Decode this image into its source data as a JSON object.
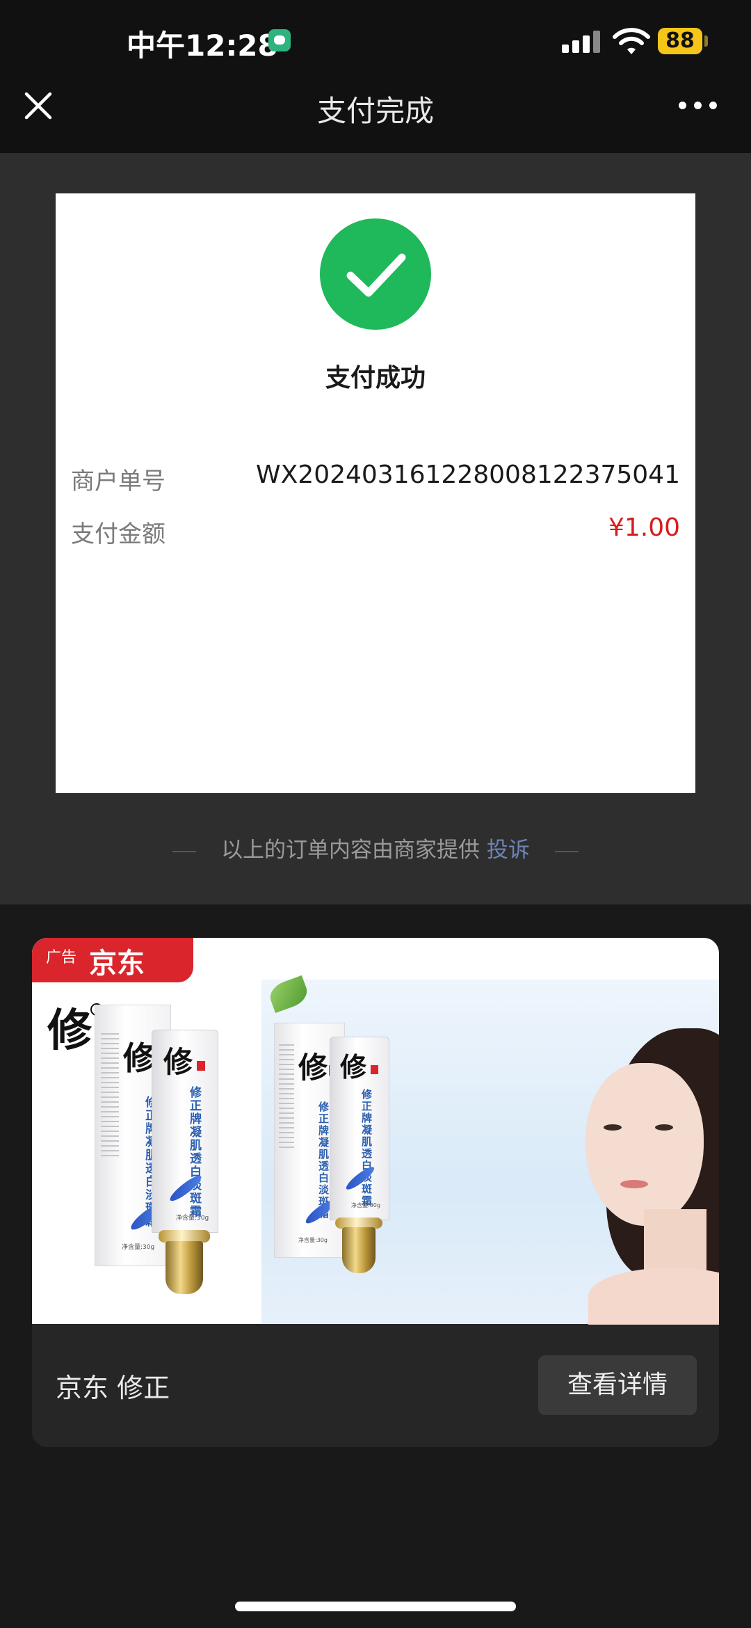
{
  "status_bar": {
    "time": "中午12:28",
    "battery": "88"
  },
  "nav": {
    "title": "支付完成"
  },
  "receipt": {
    "status": "支付成功",
    "rows": [
      {
        "label": "商户单号",
        "value": "WX20240316122800812237504​1"
      },
      {
        "label": "支付金额",
        "value": "¥1.00"
      }
    ]
  },
  "footnote": {
    "text": "以上的订单内容由商家提供",
    "link": "投诉"
  },
  "ad": {
    "badge_small": "广告",
    "badge_brand": "京东",
    "logo": "修",
    "box_name": "修正牌凝肌透白淡斑霜",
    "box_net": "净含量:30g",
    "name": "京东 修正",
    "button": "查看详情"
  },
  "colors": {
    "success": "#1fb85a",
    "amount": "#d61c1c",
    "link": "#6f84b5",
    "badge": "#d9252b"
  }
}
